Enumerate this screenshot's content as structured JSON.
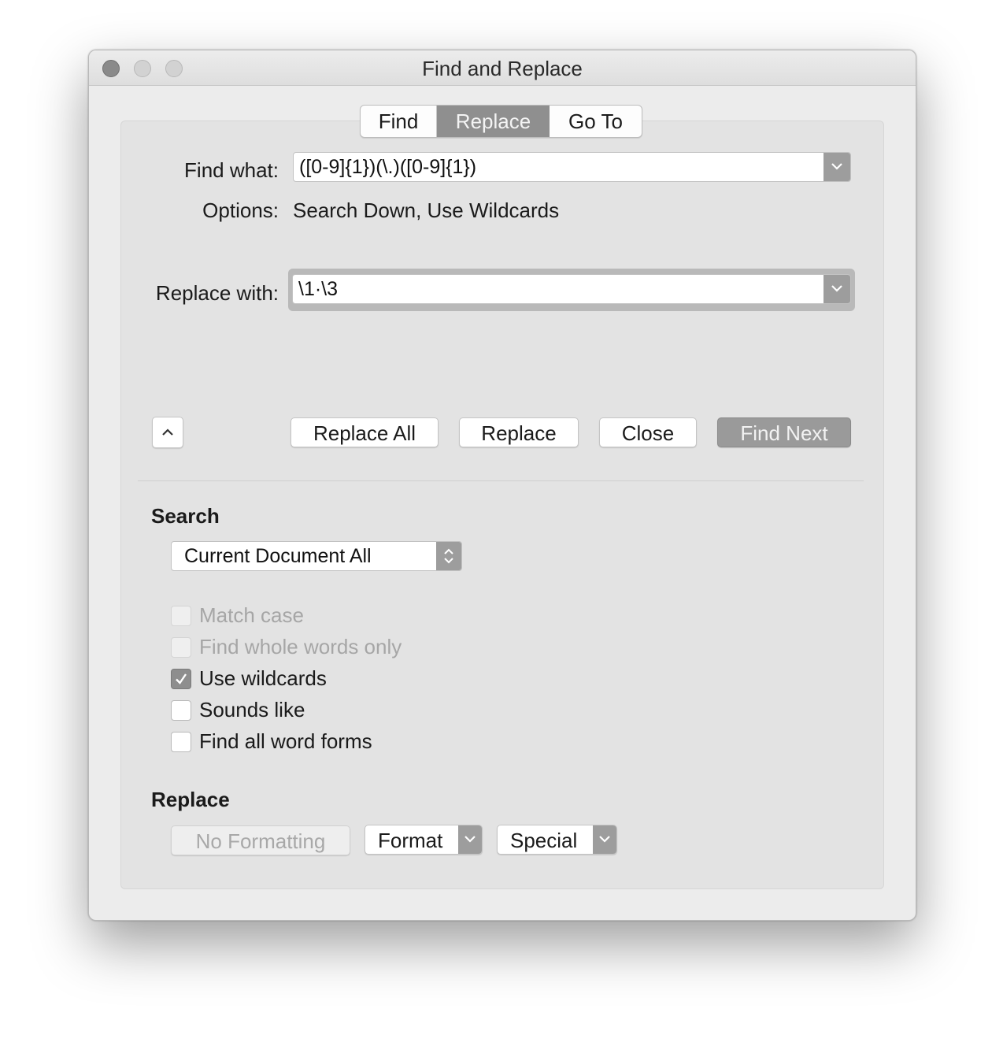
{
  "window": {
    "title": "Find and Replace"
  },
  "tabs": [
    "Find",
    "Replace",
    "Go To"
  ],
  "find": {
    "label": "Find what:",
    "value": "([0-9]{1})(\\.)([0-9]{1})"
  },
  "options": {
    "label": "Options:",
    "value": "Search Down, Use Wildcards"
  },
  "replace_field": {
    "label": "Replace with:",
    "value": "\\1·\\3"
  },
  "buttons": {
    "replace_all": "Replace All",
    "replace": "Replace",
    "close": "Close",
    "find_next": "Find Next"
  },
  "search_section": {
    "heading": "Search",
    "scope_selected": "Current Document All",
    "checkboxes": [
      {
        "label": "Match case",
        "checked": false,
        "enabled": false
      },
      {
        "label": "Find whole words only",
        "checked": false,
        "enabled": false
      },
      {
        "label": "Use wildcards",
        "checked": true,
        "enabled": true
      },
      {
        "label": "Sounds like",
        "checked": false,
        "enabled": true
      },
      {
        "label": "Find all word forms",
        "checked": false,
        "enabled": true
      }
    ]
  },
  "replace_section": {
    "heading": "Replace",
    "no_formatting": "No Formatting",
    "format": "Format",
    "special": "Special"
  },
  "icons": {
    "dropdown": "chevron-down-icon",
    "collapse": "chevron-up-icon",
    "stepper": "up-down-stepper-icon",
    "check": "checkmark-icon"
  }
}
